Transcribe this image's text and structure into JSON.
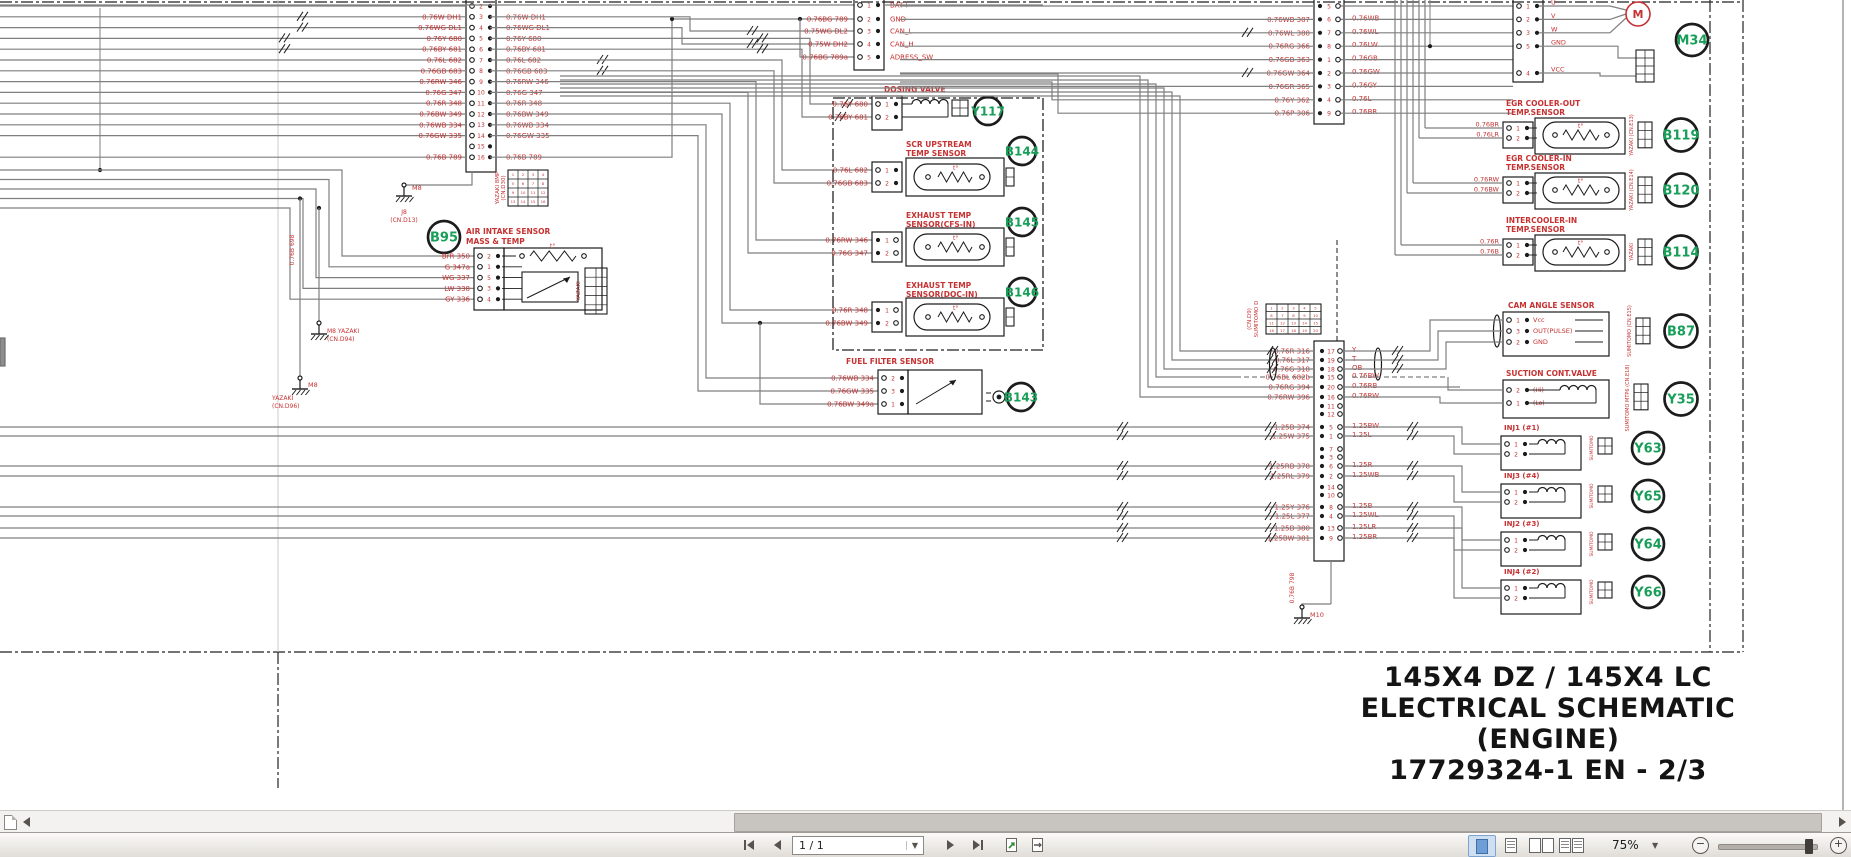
{
  "viewer": {
    "toolbar": {
      "page_field": "1 / 1",
      "zoom_value": "75%"
    },
    "icons": {
      "document": "page-corner",
      "scroll_left": "left-triangle",
      "scroll_right": "right-triangle",
      "first_page": "bar-left-triangle",
      "previous_page": "left-triangle",
      "next_page": "right-triangle",
      "last_page": "right-triangle-bar",
      "page_dropdown": "▾",
      "fit_page": "page",
      "fit_width": "page",
      "view_single": "blue-page",
      "view_continuous": "lined-page",
      "view_facing": "two-pages",
      "view_book": "two-lined-pages",
      "zoom_out": "−",
      "zoom_in": "+"
    }
  },
  "title_block": {
    "line1": "145X4 DZ / 145X4 LC",
    "line2": "ELECTRICAL SCHEMATIC (ENGINE)",
    "line3": "17729324-1 EN - 2/3"
  },
  "colors": {
    "wire": "#7f7f7f",
    "label_red": "#c63232",
    "id_green": "#189e58",
    "ink": "#1c1c1c",
    "accent_blue": "#4a7ab8"
  },
  "schematic": {
    "temp_symbol": "t°",
    "left_connector": {
      "pins": [
        {
          "n": "2",
          "label": ""
        },
        {
          "n": "3",
          "label": "0.76W DH1"
        },
        {
          "n": "4",
          "label": "0.76WG DL1"
        },
        {
          "n": "5",
          "label": "0.76Y 680"
        },
        {
          "n": "6",
          "label": "0.76BY 681"
        },
        {
          "n": "7",
          "label": "0.76L 682"
        },
        {
          "n": "8",
          "label": "0.76GB 683"
        },
        {
          "n": "9",
          "label": "0.76RW 346"
        },
        {
          "n": "10",
          "label": "0.76G 347"
        },
        {
          "n": "11",
          "label": "0.76R 348"
        },
        {
          "n": "12",
          "label": "0.76BW 349"
        },
        {
          "n": "13",
          "label": "0.76WB 334"
        },
        {
          "n": "14",
          "label": "0.76GW 335"
        },
        {
          "n": "15",
          "label": ""
        },
        {
          "n": "16",
          "label": "0.76B 789"
        }
      ]
    },
    "can_connector": {
      "pins": [
        {
          "n": "1",
          "left": "",
          "right": "BAT+"
        },
        {
          "n": "2",
          "left": "0.76BG 789",
          "right": "GND"
        },
        {
          "n": "3",
          "left": "0.75WG DL2",
          "right": "CAN_L"
        },
        {
          "n": "4",
          "left": "0.75W DH2",
          "right": "CAN_H"
        },
        {
          "n": "5",
          "left": "0.76BG 789a",
          "right": "ADRESS_SW"
        }
      ]
    },
    "b95": {
      "id": "B95",
      "name1": "AIR INTAKE SENSOR",
      "name2": "MASS & TEMP",
      "pins": [
        {
          "n": "2",
          "label": "BrR 350"
        },
        {
          "n": "1",
          "label": "G 347a"
        },
        {
          "n": "5",
          "label": "WG 337"
        },
        {
          "n": "3",
          "label": "LW 338"
        },
        {
          "n": "4",
          "label": "GY 336"
        }
      ]
    },
    "dosing_valve": {
      "id": "Y117",
      "name": "DOSING VALVE",
      "pins": [
        {
          "n": "1",
          "label": "0.76Y 680"
        },
        {
          "n": "2",
          "label": "0.76BY 681"
        }
      ]
    },
    "scr_upstream": {
      "id": "B144",
      "name1": "SCR UPSTREAM",
      "name2": "TEMP SENSOR",
      "pins": [
        {
          "n": "1",
          "label": "0.76L 682"
        },
        {
          "n": "2",
          "label": "0.76GB 683"
        }
      ]
    },
    "exhaust_cfs": {
      "id": "B145",
      "name1": "EXHAUST TEMP",
      "name2": "SENSOR(CFS-IN)",
      "pins": [
        {
          "n": "1",
          "label": "0.76RW 346"
        },
        {
          "n": "2",
          "label": "0.76G 347"
        }
      ]
    },
    "exhaust_doc": {
      "id": "B146",
      "name1": "EXHAUST TEMP",
      "name2": "SENSOR(DOC-IN)",
      "pins": [
        {
          "n": "1",
          "label": "0.76R 348"
        },
        {
          "n": "2",
          "label": "0.76BW 349"
        }
      ]
    },
    "fuel_filter": {
      "id": "B143",
      "name": "FUEL FILTER SENSOR",
      "pins": [
        {
          "n": "2",
          "label": "0.76WB 334"
        },
        {
          "n": "3",
          "label": "0.76GW 335"
        },
        {
          "n": "1",
          "label": "0.76BW 349a"
        }
      ]
    },
    "def_connector": {
      "pins": [
        {
          "n": "5",
          "left": "",
          "right": ""
        },
        {
          "n": "6",
          "left": "0.76WB 387",
          "right": "0.76WB"
        },
        {
          "n": "7",
          "left": "0.76WL 388",
          "right": "0.76WL"
        },
        {
          "n": "8",
          "left": "0.76RG 366",
          "right": "0.76LW"
        },
        {
          "n": "1",
          "left": "0.76GB 363",
          "right": "0.76GB"
        },
        {
          "n": "2",
          "left": "0.76GW 364",
          "right": "0.76GW"
        },
        {
          "n": "3",
          "left": "0.76GR 365",
          "right": "0.76GY"
        },
        {
          "n": "4",
          "left": "0.76Y 362",
          "right": "0.76L"
        },
        {
          "n": "9",
          "left": "0.76P 306",
          "right": "0.76BR"
        }
      ]
    },
    "pump_connector": {
      "pins": [
        {
          "n": "1",
          "label": "U"
        },
        {
          "n": "2",
          "label": "V"
        },
        {
          "n": "3",
          "label": "W"
        },
        {
          "n": "5",
          "label": "GND"
        },
        {
          "n": "4",
          "label": "VCC"
        }
      ]
    },
    "motor": {
      "symbol": "M",
      "id": "M34"
    },
    "egr_out": {
      "id": "B119",
      "name1": "EGR COOLER-OUT",
      "name2": "TEMP.SENSOR",
      "tag": "YAZAKI (CN.E13)",
      "pins": [
        {
          "n": "1",
          "label": "0.76BR"
        },
        {
          "n": "2",
          "label": "0.76LR"
        }
      ]
    },
    "egr_in": {
      "id": "B120",
      "name1": "EGR COOLER-IN",
      "name2": "TEMP.SENSOR",
      "tag": "YAZAKI (CN.E14)",
      "pins": [
        {
          "n": "1",
          "label": "0.76RW"
        },
        {
          "n": "2",
          "label": "0.76BW"
        }
      ]
    },
    "intercooler": {
      "id": "B114",
      "name1": "INTERCOOLER-IN",
      "name2": "TEMP.SENSOR",
      "tag": "YAZAKI",
      "pins": [
        {
          "n": "1",
          "label": "0.76R"
        },
        {
          "n": "2",
          "label": "0.76B"
        }
      ]
    },
    "cam_sensor": {
      "id": "B87",
      "name": "CAM ANGLE SENSOR",
      "tag": "SUMITOMO (CN.E15)",
      "pins": [
        {
          "n": "1",
          "label": "Vcc"
        },
        {
          "n": "3",
          "label": "OUT(PULSE)"
        },
        {
          "n": "2",
          "label": "GND"
        }
      ]
    },
    "suction_valve": {
      "id": "Y35",
      "name": "SUCTION CONT.VALVE",
      "tag": "SUMITOMO MTP6 (CN.E18)",
      "pins": [
        {
          "n": "2",
          "label": "(Hi)"
        },
        {
          "n": "1",
          "label": "(Lo)"
        }
      ]
    },
    "injectors": [
      {
        "id": "Y63",
        "name": "INJ1 (#1)",
        "tag": "SUMITOMO"
      },
      {
        "id": "Y65",
        "name": "INJ3 (#4)",
        "tag": "SUMITOMO"
      },
      {
        "id": "Y64",
        "name": "INJ2 (#3)",
        "tag": "SUMITOMO"
      },
      {
        "id": "Y66",
        "name": "INJ4 (#2)",
        "tag": "SUMITOMO"
      }
    ],
    "ecu_connector": {
      "tag1": "SUMITOMO D",
      "tag2": "(CN.D9)",
      "pins": [
        {
          "n": "17",
          "left": "0.76R 316",
          "right": "Y"
        },
        {
          "n": "19",
          "left": "0.76L 317",
          "right": "T"
        },
        {
          "n": "18",
          "left": "0.76G 318",
          "right": "OB"
        },
        {
          "n": "15",
          "left": "0.76BL 682b",
          "right": "0.76BW"
        },
        {
          "n": "20",
          "left": "0.76RG 394",
          "right": "0.76RB"
        },
        {
          "n": "16",
          "left": "0.76RW 396",
          "right": "0.76RW"
        },
        {
          "n": "11",
          "left": "",
          "right": ""
        },
        {
          "n": "12",
          "left": "",
          "right": ""
        },
        {
          "n": "5",
          "left": "1.25B 374",
          "right": "1.25BW"
        },
        {
          "n": "1",
          "left": "1.25W 375",
          "right": "1.25L"
        },
        {
          "n": "7",
          "left": "",
          "right": ""
        },
        {
          "n": "3",
          "left": "",
          "right": ""
        },
        {
          "n": "6",
          "left": "1.25RB 378",
          "right": "1.25R"
        },
        {
          "n": "2",
          "left": "1.25RL 379",
          "right": "1.25WB"
        },
        {
          "n": "14",
          "left": "",
          "right": ""
        },
        {
          "n": "10",
          "left": "",
          "right": ""
        },
        {
          "n": "8",
          "left": "1.25Y 376",
          "right": "1.25B"
        },
        {
          "n": "4",
          "left": "1.25L 377",
          "right": "1.25WL"
        },
        {
          "n": "13",
          "left": "1.25B 380",
          "right": "1.25LR"
        },
        {
          "n": "9",
          "left": "1.25BW 381",
          "right": "1.25BR"
        }
      ]
    },
    "grounds": {
      "g1": {
        "id": "M8",
        "tag1": "J8",
        "tag2": "(CN.D13)"
      },
      "g2": {
        "tag1": "M8 YAZAKI",
        "tag2": "(CN.D94)"
      },
      "g3": {
        "id": "M8",
        "tag1": "YAZAKI",
        "tag2": "(CN.D96)"
      },
      "g4": {
        "id": "M10",
        "wire": "0.76B 798"
      },
      "wire_tag": "0.76B 698"
    },
    "junctions": {
      "d30a": "YAZAKI 8MP",
      "d30b": "(CN.D30)",
      "small_left": "YAZAKI"
    }
  }
}
